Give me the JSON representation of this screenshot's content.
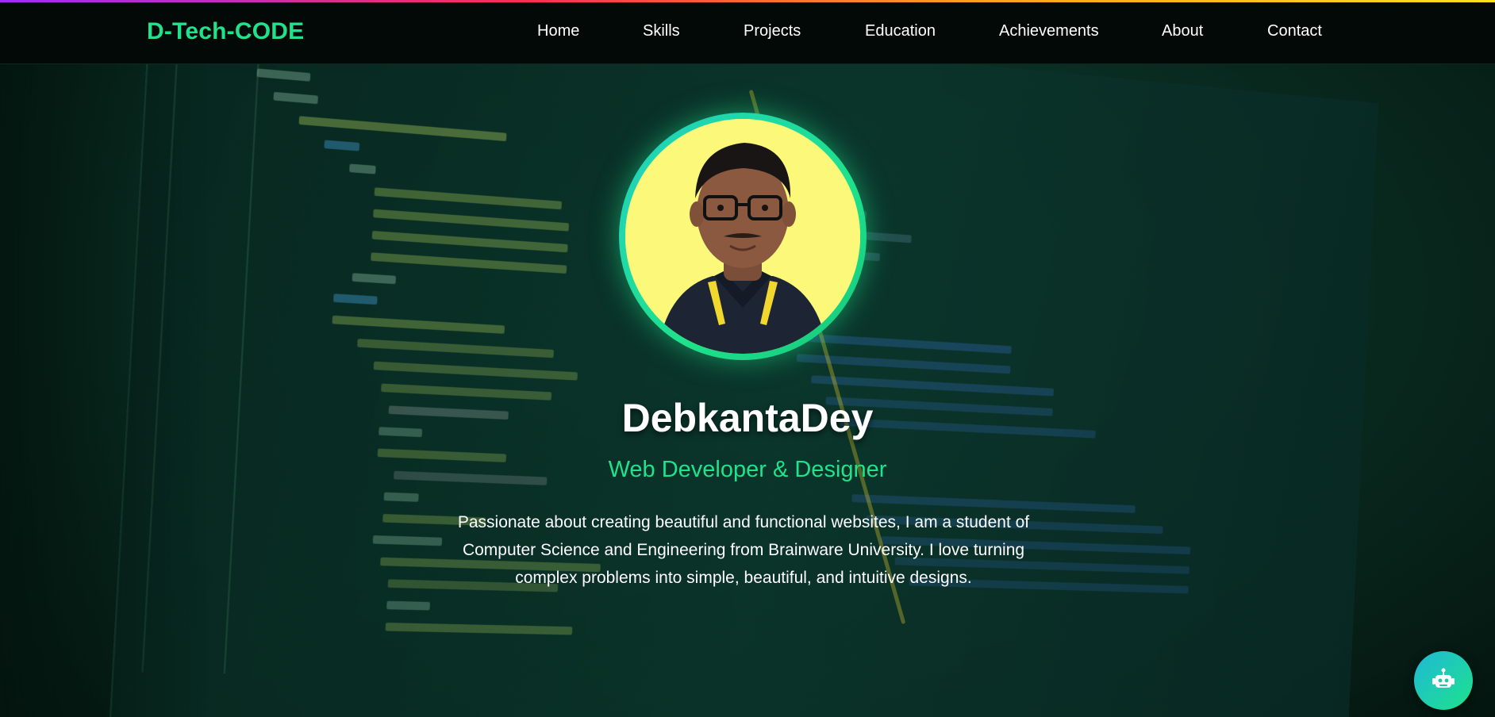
{
  "brand": {
    "logo": "D-Tech-CODE"
  },
  "nav": {
    "items": [
      {
        "label": "Home"
      },
      {
        "label": "Skills"
      },
      {
        "label": "Projects"
      },
      {
        "label": "Education"
      },
      {
        "label": "Achievements"
      },
      {
        "label": "About"
      },
      {
        "label": "Contact"
      }
    ]
  },
  "hero": {
    "name": "DebkantaDey",
    "tagline": "Web Developer & Designer",
    "bio": "Passionate about creating beautiful and functional websites, I am a student of Computer Science and Engineering from Brainware University. I love turning complex problems into simple, beautiful, and intuitive designs.",
    "avatar_icon": "profile-photo"
  },
  "chat_widget": {
    "icon": "robot-icon"
  },
  "colors": {
    "accent": "#1ee28c",
    "navbar_bg": "#020907",
    "avatar_bg": "#fcf87a",
    "text": "#ffffff"
  }
}
